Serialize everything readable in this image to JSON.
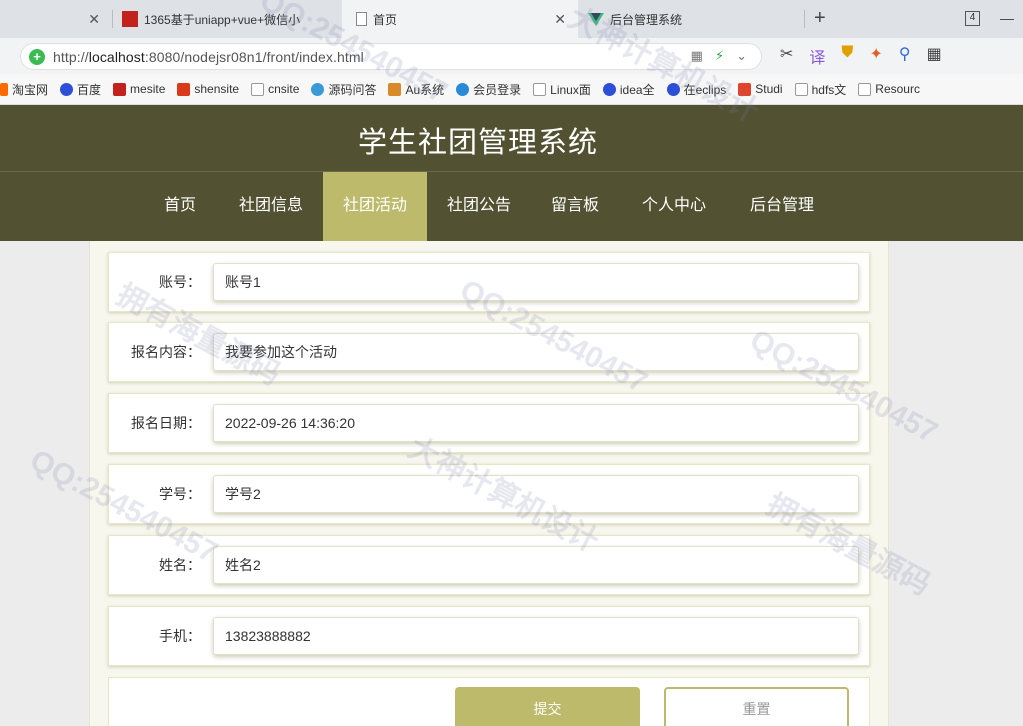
{
  "browser": {
    "tabs": [
      {
        "title": "",
        "active": false
      },
      {
        "title": "1365基于uniapp+vue+微信小",
        "active": false
      },
      {
        "title": "首页",
        "active": true
      },
      {
        "title": "后台管理系统",
        "active": false
      }
    ],
    "new_tab": "+",
    "tab_count": "4",
    "url_scheme": "http://",
    "url_host": "localhost",
    "url_rest": ":8080/nodejsr08n1/front/index.html",
    "bookmarks": [
      "淘宝网",
      "百度",
      "mesite",
      "shensite",
      "cnsite",
      "源码问答",
      "Au系统",
      "会员登录",
      "Linux面",
      "idea全",
      "在eclips",
      "Studi",
      "hdfs文",
      "Resourc"
    ]
  },
  "site": {
    "title": "学生社团管理系统",
    "nav": [
      "首页",
      "社团信息",
      "社团活动",
      "社团公告",
      "留言板",
      "个人中心",
      "后台管理"
    ],
    "active_nav": "社团活动"
  },
  "form": {
    "fields": [
      {
        "label": "账号：",
        "value": "账号1"
      },
      {
        "label": "报名内容：",
        "value": "我要参加这个活动"
      },
      {
        "label": "报名日期：",
        "value": "2022-09-26 14:36:20"
      },
      {
        "label": "学号：",
        "value": "学号2"
      },
      {
        "label": "姓名：",
        "value": "姓名2"
      },
      {
        "label": "手机：",
        "value": "13823888882"
      }
    ],
    "submit_label": "提交",
    "reset_label": "重置"
  },
  "watermarks": [
    "QQ:254540457",
    "大神计算机设计",
    "拥有海量源码"
  ],
  "colors": {
    "header": "#525232",
    "accent": "#bdbb6b"
  }
}
